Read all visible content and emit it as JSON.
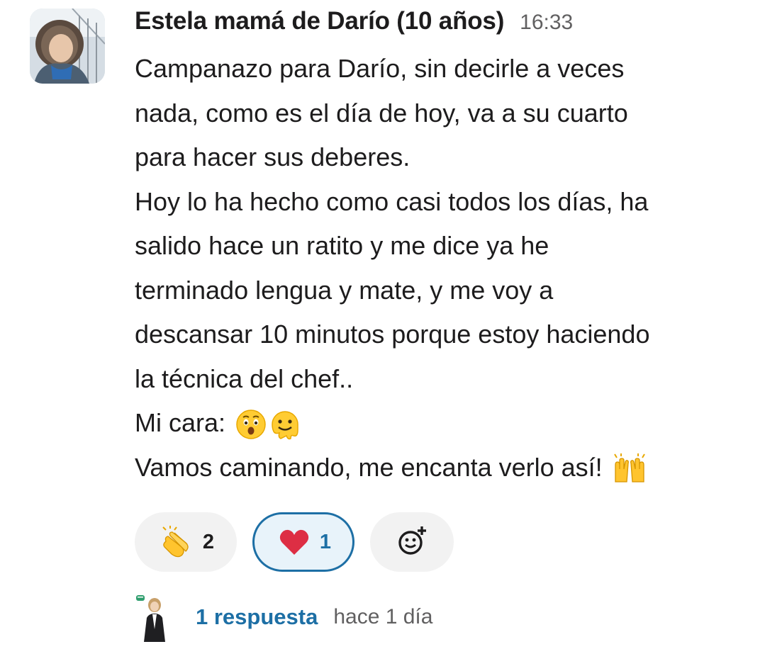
{
  "message": {
    "author": "Estela mamá de Darío (10 años)",
    "timestamp": "16:33",
    "lines": [
      "Campanazo para Darío, sin decirle a veces",
      "nada, como es el día de hoy, va a su cuarto",
      "para hacer sus deberes.",
      "Hoy lo ha hecho como casi todos los días, ha",
      "salido hace un ratito y me dice ya he",
      "terminado lengua y mate, y me voy a",
      "descansar 10 minutos porque estoy haciendo",
      "la técnica del chef..",
      "Mi cara: ",
      "Vamos caminando, me encanta verlo así! "
    ],
    "emojis": {
      "surprised": "hushed-face-emoji",
      "melting": "melting-face-emoji",
      "raised_hands": "raising-hands-emoji"
    }
  },
  "reactions": [
    {
      "icon": "clapping-hands-emoji",
      "count": "2",
      "active": false
    },
    {
      "icon": "red-heart-emoji",
      "count": "1",
      "active": true
    }
  ],
  "add_reaction": {
    "icon": "add-reaction-icon"
  },
  "thread": {
    "replies_label": "1 respuesta",
    "last_reply": "hace 1 día"
  },
  "colors": {
    "link_blue": "#1d6fa5",
    "text": "#1d1c1d",
    "muted": "#616061",
    "pill_bg": "#f2f2f2",
    "active_pill_bg": "#e8f3fa"
  }
}
